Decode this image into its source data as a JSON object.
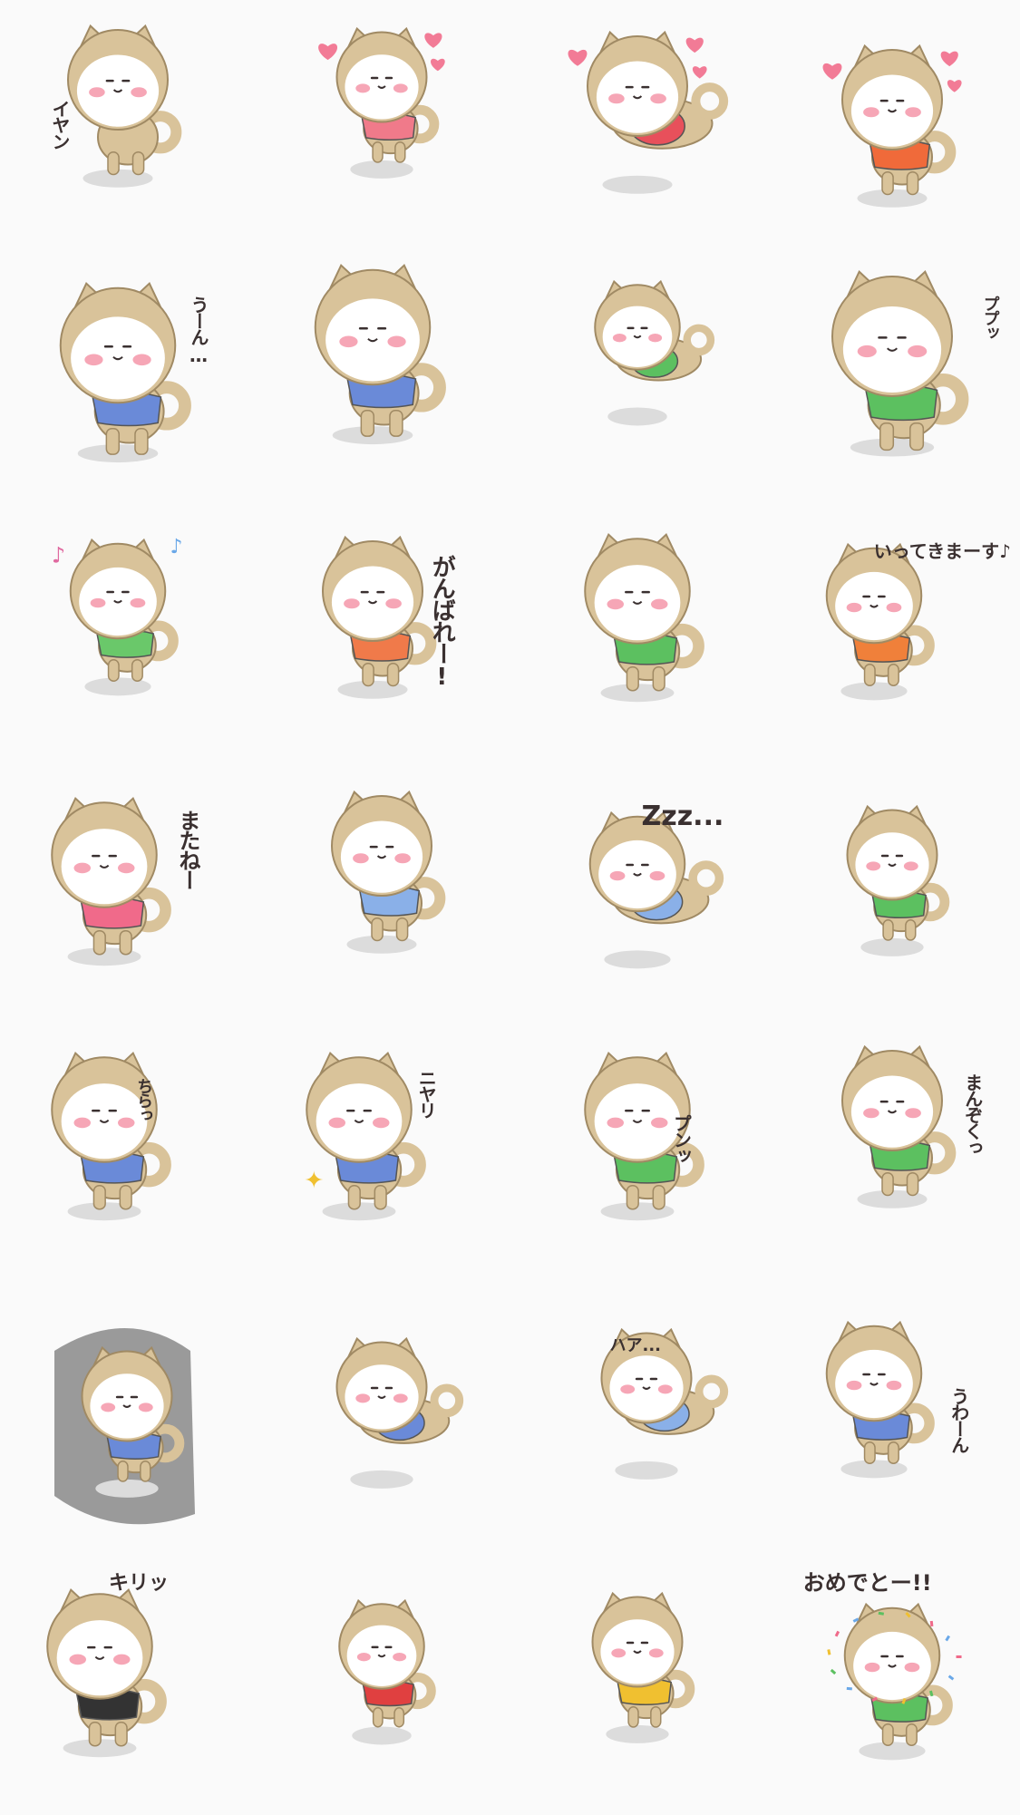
{
  "palette": {
    "fur": "#d9c39a",
    "fur_line": "#a08a64",
    "face": "#ffffff",
    "blush": "#f6a6b6",
    "ink": "#3a3030",
    "shadow": "#dcdcdc",
    "heart": "#f27b96"
  },
  "stickers": [
    {
      "id": 1,
      "caption": "イヤン",
      "shirt": "",
      "accent": "",
      "icon": "shy-dog-icon"
    },
    {
      "id": 2,
      "caption": "",
      "shirt": "#f07a8a",
      "accent": "heart",
      "icon": "love-eyes-dog-icon"
    },
    {
      "id": 3,
      "caption": "",
      "shirt": "#e8505b",
      "accent": "heart",
      "icon": "lying-dog-icon"
    },
    {
      "id": 4,
      "caption": "",
      "shirt": "#f06a3a",
      "accent": "heart",
      "icon": "hearts-dog-icon"
    },
    {
      "id": 5,
      "caption": "うーん…",
      "shirt": "#6a8ad8",
      "accent": "",
      "icon": "thinking-dog-icon"
    },
    {
      "id": 6,
      "caption": "",
      "shirt": "#6a8ad8",
      "accent": "",
      "icon": "crying-dog-icon"
    },
    {
      "id": 7,
      "caption": "",
      "shirt": "#5cc060",
      "accent": "",
      "icon": "lazy-dog-icon"
    },
    {
      "id": 8,
      "caption": "ププッ",
      "shirt": "#5cc060",
      "accent": "",
      "icon": "giggle-dog-icon"
    },
    {
      "id": 9,
      "caption": "",
      "shirt": "#6ac86a",
      "accent": "music",
      "icon": "dancing-dog-icon"
    },
    {
      "id": 10,
      "caption": "がんばれー!",
      "shirt": "#f07a4a",
      "accent": "",
      "icon": "cheer-dog-icon"
    },
    {
      "id": 11,
      "caption": "",
      "shirt": "#5cc060",
      "accent": "",
      "icon": "sitting-dog-icon"
    },
    {
      "id": 12,
      "caption": "いってきまーす♪",
      "shirt": "#f0803a",
      "accent": "",
      "icon": "walking-dog-icon"
    },
    {
      "id": 13,
      "caption": "またねー",
      "shirt": "#f06a8a",
      "accent": "",
      "icon": "waving-dog-icon"
    },
    {
      "id": 14,
      "caption": "",
      "shirt": "#8ab0e8",
      "accent": "",
      "icon": "pajama-dog-icon"
    },
    {
      "id": 15,
      "caption": "Zzz...",
      "shirt": "#8ab0e8",
      "accent": "",
      "icon": "sleeping-dog-icon"
    },
    {
      "id": 16,
      "caption": "",
      "shirt": "#5cc060",
      "accent": "",
      "icon": "shocked-dog-icon"
    },
    {
      "id": 17,
      "caption": "ちらっ",
      "shirt": "#6a8ad8",
      "accent": "",
      "icon": "peek-dog-icon"
    },
    {
      "id": 18,
      "caption": "ニヤリ",
      "shirt": "#6a8ad8",
      "accent": "sparkle",
      "icon": "smirk-dog-icon"
    },
    {
      "id": 19,
      "caption": "プンッ",
      "shirt": "#5cc060",
      "accent": "",
      "icon": "pouting-dog-icon"
    },
    {
      "id": 20,
      "caption": "まんぞくっ",
      "shirt": "#5cc060",
      "accent": "",
      "icon": "satisfied-dog-icon"
    },
    {
      "id": 21,
      "caption": "",
      "shirt": "#6a8ad8",
      "accent": "",
      "icon": "corner-dog-icon"
    },
    {
      "id": 22,
      "caption": "",
      "shirt": "#6a8ad8",
      "accent": "",
      "icon": "collapsed-dog-icon"
    },
    {
      "id": 23,
      "caption": "ハア...",
      "shirt": "#8ab0e8",
      "accent": "",
      "icon": "tired-dog-icon"
    },
    {
      "id": 24,
      "caption": "うわーん",
      "shirt": "#6a8ad8",
      "accent": "",
      "icon": "wailing-dog-icon"
    },
    {
      "id": 25,
      "caption": "キリッ",
      "shirt": "#333333",
      "accent": "",
      "icon": "glasses-dog-icon"
    },
    {
      "id": 26,
      "caption": "",
      "shirt": "#e04040",
      "accent": "",
      "icon": "snowman-dog-icon"
    },
    {
      "id": 27,
      "caption": "",
      "shirt": "#f0c030",
      "accent": "",
      "icon": "skiing-dog-icon"
    },
    {
      "id": 28,
      "caption": "おめでとー!!",
      "shirt": "#5cc060",
      "accent": "confetti",
      "icon": "celebrate-dog-icon"
    }
  ]
}
